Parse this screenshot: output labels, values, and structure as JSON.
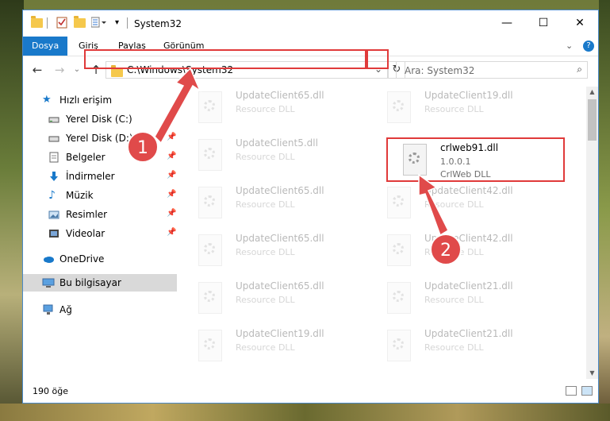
{
  "window": {
    "title": "System32",
    "minimize": "—",
    "maximize": "☐",
    "close": "✕"
  },
  "ribbon": {
    "tabs": [
      "Dosya",
      "Giriş",
      "Paylaş",
      "Görünüm"
    ],
    "expand": "⌄",
    "help": "?"
  },
  "nav": {
    "back": "←",
    "forward": "→",
    "dropdown": "⌄",
    "up": "↑",
    "address": "C:\\Windows\\System32",
    "address_dropdown": "⌄",
    "refresh": "↻",
    "search_placeholder": "Ara: System32",
    "search_icon": "⌕"
  },
  "sidebar": {
    "quick_access": "Hızlı erişim",
    "items": [
      {
        "label": "Yerel Disk (C:)",
        "icon": "drive-icon",
        "pinned": true
      },
      {
        "label": "Yerel Disk (D:)",
        "icon": "drive-icon",
        "pinned": true
      },
      {
        "label": "Belgeler",
        "icon": "documents-icon",
        "pinned": true
      },
      {
        "label": "İndirmeler",
        "icon": "downloads-icon",
        "pinned": true
      },
      {
        "label": "Müzik",
        "icon": "music-icon",
        "pinned": true
      },
      {
        "label": "Resimler",
        "icon": "pictures-icon",
        "pinned": true
      },
      {
        "label": "Videolar",
        "icon": "videos-icon",
        "pinned": true
      }
    ],
    "onedrive": "OneDrive",
    "this_pc": "Bu bilgisayar",
    "network": "Ağ"
  },
  "files": {
    "left": [
      {
        "name": "UpdateClient65.dll",
        "type": "Resource DLL"
      },
      {
        "name": "UpdateClient5.dll",
        "type": "Resource DLL"
      },
      {
        "name": "UpdateClient65.dll",
        "type": "Resource DLL"
      },
      {
        "name": "UpdateClient65.dll",
        "type": "Resource DLL"
      },
      {
        "name": "UpdateClient65.dll",
        "type": "Resource DLL"
      },
      {
        "name": "UpdateClient19.dll",
        "type": "Resource DLL"
      }
    ],
    "right": [
      {
        "name": "UpdateClient19.dll",
        "type": "Resource DLL"
      },
      {
        "name": "UpdateClient42.dll",
        "type": "Resource DLL"
      },
      {
        "name": "UpdateClient42.dll",
        "type": "Resource DLL"
      },
      {
        "name": "UpdateClient21.dll",
        "type": "Resource DLL"
      },
      {
        "name": "UpdateClient21.dll",
        "type": "Resource DLL"
      }
    ],
    "highlighted": {
      "name": "crlweb91.dll",
      "version": "1.0.0.1",
      "type": "CrlWeb DLL"
    }
  },
  "status": {
    "count": "190 öğe"
  },
  "annotations": {
    "step1": "1",
    "step2": "2",
    "color": "#e03a3a"
  }
}
